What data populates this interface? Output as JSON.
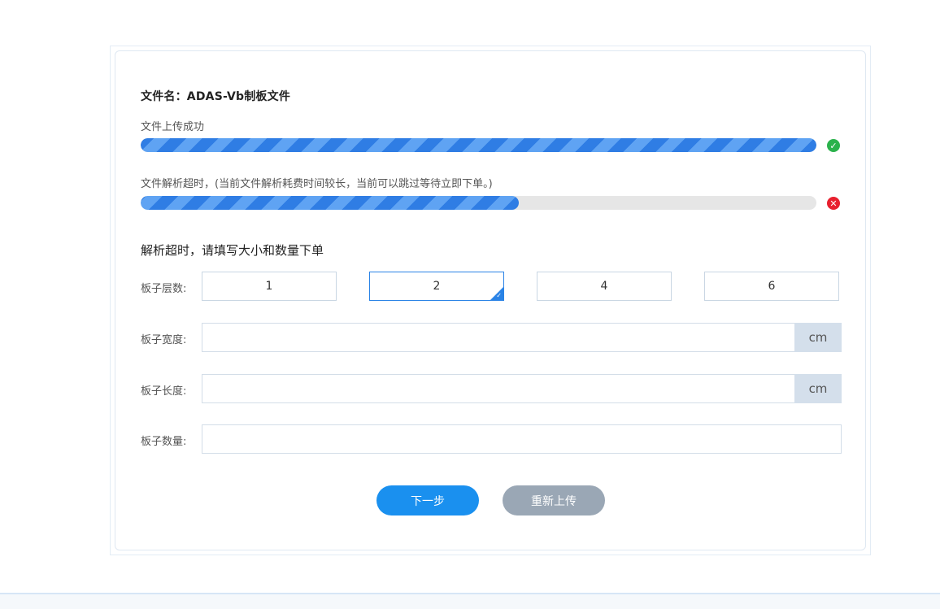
{
  "file": {
    "name_label": "文件名：ADAS-Vb制板文件"
  },
  "upload": {
    "status_text": "文件上传成功",
    "progress": 1.0,
    "status_icon": "check-circle-icon",
    "icon_color": "#2bb24c"
  },
  "parse": {
    "status_text": "文件解析超时，(当前文件解析耗费时间较长，当前可以跳过等待立即下单。)",
    "progress": 0.56,
    "status_icon": "error-circle-icon",
    "icon_color": "#e8202e"
  },
  "form": {
    "heading": "解析超时，请填写大小和数量下单",
    "layers": {
      "label": "板子层数:",
      "options": [
        "1",
        "2",
        "4",
        "6"
      ],
      "selected": "2"
    },
    "width": {
      "label": "板子宽度:",
      "value": "",
      "unit": "cm"
    },
    "length": {
      "label": "板子长度:",
      "value": "",
      "unit": "cm"
    },
    "quantity": {
      "label": "板子数量:",
      "value": ""
    }
  },
  "buttons": {
    "next": "下一步",
    "reupload": "重新上传"
  },
  "colors": {
    "accent": "#1a90ef",
    "progress_stripe_dark": "#2f7de4",
    "progress_stripe_light": "#5fa3f3",
    "secondary_button": "#9aa7b5"
  }
}
